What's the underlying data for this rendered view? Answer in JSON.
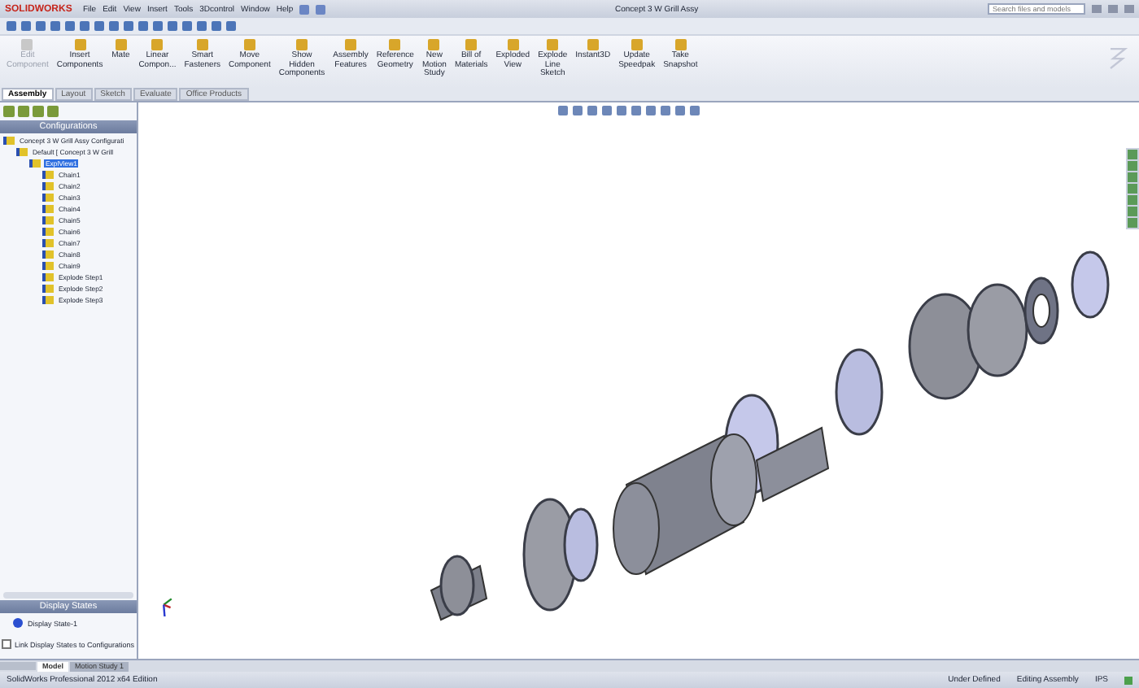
{
  "app": {
    "logo": "SOLIDWORKS",
    "menus": [
      "File",
      "Edit",
      "View",
      "Insert",
      "Tools",
      "3Dcontrol",
      "Window",
      "Help"
    ],
    "title": "Concept 3 W Grill Assy",
    "search": {
      "placeholder": "Search files and models"
    }
  },
  "commands": [
    {
      "label": "Edit Component",
      "disabled": true
    },
    {
      "label": "Insert Components",
      "disabled": false
    },
    {
      "label": "Mate",
      "disabled": false
    },
    {
      "label": "Linear Compon...",
      "disabled": false
    },
    {
      "label": "Smart Fasteners",
      "disabled": false
    },
    {
      "label": "Move Component",
      "disabled": false
    },
    {
      "label": "Show Hidden Components",
      "disabled": false
    },
    {
      "label": "Assembly Features",
      "disabled": false
    },
    {
      "label": "Reference Geometry",
      "disabled": false
    },
    {
      "label": "New Motion Study",
      "disabled": false
    },
    {
      "label": "Bill of Materials",
      "disabled": false
    },
    {
      "label": "Exploded View",
      "disabled": false
    },
    {
      "label": "Explode Line Sketch",
      "disabled": false
    },
    {
      "label": "Instant3D",
      "disabled": false
    },
    {
      "label": "Update Speedpak",
      "disabled": false
    },
    {
      "label": "Take Snapshot",
      "disabled": false
    }
  ],
  "tabs": [
    {
      "label": "Assembly",
      "selected": true
    },
    {
      "label": "Layout",
      "selected": false
    },
    {
      "label": "Sketch",
      "selected": false
    },
    {
      "label": "Evaluate",
      "selected": false
    },
    {
      "label": "Office Products",
      "selected": false
    }
  ],
  "config_panel": {
    "title": "Configurations",
    "tree": [
      {
        "label": "Concept 3 W Grill Assy Configurati",
        "selected": false,
        "children": [
          {
            "label": "Default [ Concept 3 W Grill",
            "selected": false,
            "children": [
              {
                "label": "ExplView1",
                "selected": true,
                "children": [
                  {
                    "label": "Chain1",
                    "selected": false
                  },
                  {
                    "label": "Chain2",
                    "selected": false
                  },
                  {
                    "label": "Chain3",
                    "selected": false
                  },
                  {
                    "label": "Chain4",
                    "selected": false
                  },
                  {
                    "label": "Chain5",
                    "selected": false
                  },
                  {
                    "label": "Chain6",
                    "selected": false
                  },
                  {
                    "label": "Chain7",
                    "selected": false
                  },
                  {
                    "label": "Chain8",
                    "selected": false
                  },
                  {
                    "label": "Chain9",
                    "selected": false
                  },
                  {
                    "label": "Explode Step1",
                    "selected": false
                  },
                  {
                    "label": "Explode Step2",
                    "selected": false
                  },
                  {
                    "label": "Explode Step3",
                    "selected": false
                  }
                ]
              }
            ]
          }
        ]
      }
    ]
  },
  "display_states": {
    "title": "Display States",
    "items": [
      "Display State-1"
    ],
    "link_option": {
      "label": "Link Display States to Configurations",
      "checked": false
    }
  },
  "bottom_tabs": [
    {
      "label": "Model",
      "selected": true
    },
    {
      "label": "Motion Study 1",
      "selected": false
    }
  ],
  "status_bar": {
    "product": "SolidWorks Professional 2012 x64 Edition",
    "state": "Under Defined",
    "mode": "Editing Assembly",
    "units": "IPS"
  }
}
